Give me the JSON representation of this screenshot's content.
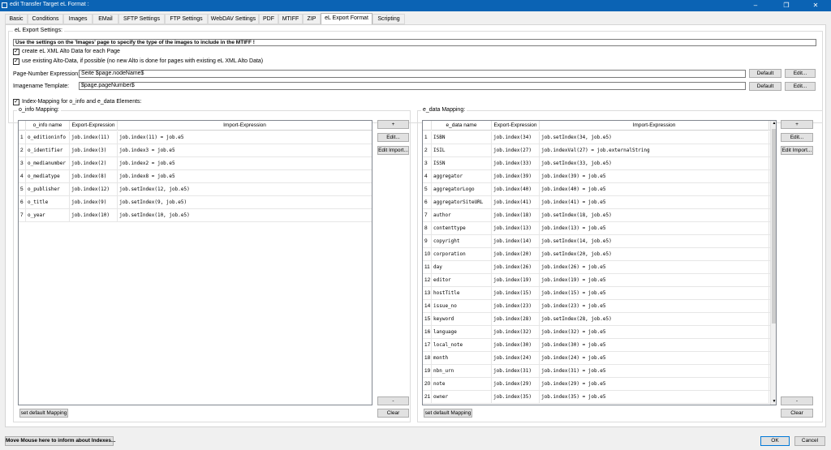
{
  "window": {
    "title": "edit Transfer Target eL Format :",
    "minimize_icon": "minimize-icon",
    "maximize_icon": "restore-icon",
    "close_icon": "close-icon"
  },
  "tabs": [
    "Basic",
    "Conditions",
    "Images",
    "EMail",
    "SFTP Settings",
    "FTP Settings",
    "WebDAV Settings",
    "PDF",
    "MTIFF",
    "ZIP",
    "eL Export Format",
    "Scripting"
  ],
  "active_tab": "eL Export Format",
  "export_settings": {
    "group_label": "eL Export Settings:",
    "info_text": "Use the settings on the 'Images' page to specify the type of the images to include in the MTIFF !",
    "cb_alto_label": "create eL XML Alto Data for each Page",
    "cb_existing_label": "use existing Alto-Data, if possible (no new Alto is done for pages with existing eL XML Alto Data)",
    "page_number_label": "Page-Number Expression:",
    "page_number_value": "Seite $page.nodeName$",
    "imagename_label": "Imagename Template:",
    "imagename_value": "$page.pageNumber$",
    "default_label": "Default",
    "edit_label": "Edit..."
  },
  "index_mapping": {
    "label": "Index-Mapping for o_info and e_data Elements:"
  },
  "o_info": {
    "group_label": "o_info Mapping:",
    "columns": [
      "o_info name",
      "Export-Expression",
      "Import-Expression"
    ],
    "rows": [
      {
        "n": "1",
        "name": "o_editioninfo",
        "export": "job.index(11)",
        "import": "job.index(11) = job.e5"
      },
      {
        "n": "2",
        "name": "o_identifier",
        "export": "job.index(3)",
        "import": "job.index3 = job.e5"
      },
      {
        "n": "3",
        "name": "o_medianumber",
        "export": "job.index(2)",
        "import": "job.index2 = job.e5"
      },
      {
        "n": "4",
        "name": "o_mediatype",
        "export": "job.index(8)",
        "import": "job.index8 = job.e5"
      },
      {
        "n": "5",
        "name": "o_publisher",
        "export": "job.index(12)",
        "import": "job.setIndex(12, job.e5)"
      },
      {
        "n": "6",
        "name": "o_title",
        "export": "job.index(9)",
        "import": "job.setIndex(9, job.e5)"
      },
      {
        "n": "7",
        "name": "o_year",
        "export": "job.index(10)",
        "import": "job.setIndex(10, job.e5)"
      }
    ],
    "add_label": "+",
    "edit_label": "Edit...",
    "edit_import_label": "Edit Import...",
    "remove_label": "-",
    "default_mapping_label": "set default Mapping",
    "clear_label": "Clear"
  },
  "e_data": {
    "group_label": "e_data Mapping:",
    "columns": [
      "e_data name",
      "Export-Expression",
      "Import-Expression"
    ],
    "rows": [
      {
        "n": "1",
        "name": "ISBN",
        "export": "job.index(34)",
        "import": "job.setIndex(34, job.e5)"
      },
      {
        "n": "2",
        "name": "ISIL",
        "export": "job.index(27)",
        "import": "job.indexVal(27) = job.externalString"
      },
      {
        "n": "3",
        "name": "ISSN",
        "export": "job.index(33)",
        "import": "job.setIndex(33, job.e5)"
      },
      {
        "n": "4",
        "name": "aggregator",
        "export": "job.index(39)",
        "import": "job.index(39) = job.e5"
      },
      {
        "n": "5",
        "name": "aggregatorLogo",
        "export": "job.index(40)",
        "import": "job.index(40) = job.e5"
      },
      {
        "n": "6",
        "name": "aggregatorSiteURL",
        "export": "job.index(41)",
        "import": "job.index(41) = job.e5"
      },
      {
        "n": "7",
        "name": "author",
        "export": "job.index(18)",
        "import": "job.setIndex(18, job.e5)"
      },
      {
        "n": "8",
        "name": "contenttype",
        "export": "job.index(13)",
        "import": "job.index(13) = job.e5"
      },
      {
        "n": "9",
        "name": "copyright",
        "export": "job.index(14)",
        "import": "job.setIndex(14, job.e5)"
      },
      {
        "n": "10",
        "name": "corporation",
        "export": "job.index(20)",
        "import": "job.setIndex(20, job.e5)"
      },
      {
        "n": "11",
        "name": "day",
        "export": "job.index(26)",
        "import": "job.index(26) = job.e5"
      },
      {
        "n": "12",
        "name": "editor",
        "export": "job.index(19)",
        "import": "job.index(19) = job.e5"
      },
      {
        "n": "13",
        "name": "hostTitle",
        "export": "job.index(15)",
        "import": "job.index(15) = job.e5"
      },
      {
        "n": "14",
        "name": "issue_no",
        "export": "job.index(23)",
        "import": "job.index(23) = job.e5"
      },
      {
        "n": "15",
        "name": "keyword",
        "export": "job.index(28)",
        "import": "job.setIndex(28, job.e5)"
      },
      {
        "n": "16",
        "name": "language",
        "export": "job.index(32)",
        "import": "job.index(32) = job.e5"
      },
      {
        "n": "17",
        "name": "local_note",
        "export": "job.index(30)",
        "import": "job.index(30) = job.e5"
      },
      {
        "n": "18",
        "name": "month",
        "export": "job.index(24)",
        "import": "job.index(24) = job.e5"
      },
      {
        "n": "19",
        "name": "nbn_urn",
        "export": "job.index(31)",
        "import": "job.index(31) = job.e5"
      },
      {
        "n": "20",
        "name": "note",
        "export": "job.index(29)",
        "import": "job.index(29) = job.e5"
      },
      {
        "n": "21",
        "name": "owner",
        "export": "job.index(35)",
        "import": "job.index(35) = job.e5"
      }
    ],
    "add_label": "+",
    "edit_label": "Edit...",
    "edit_import_label": "Edit Import...",
    "remove_label": "-",
    "default_mapping_label": "set default Mapping",
    "clear_label": "Clear"
  },
  "footer": {
    "info_button": "Move Mouse here to inform about Indexes...",
    "ok_label": "OK",
    "cancel_label": "Cancel"
  }
}
